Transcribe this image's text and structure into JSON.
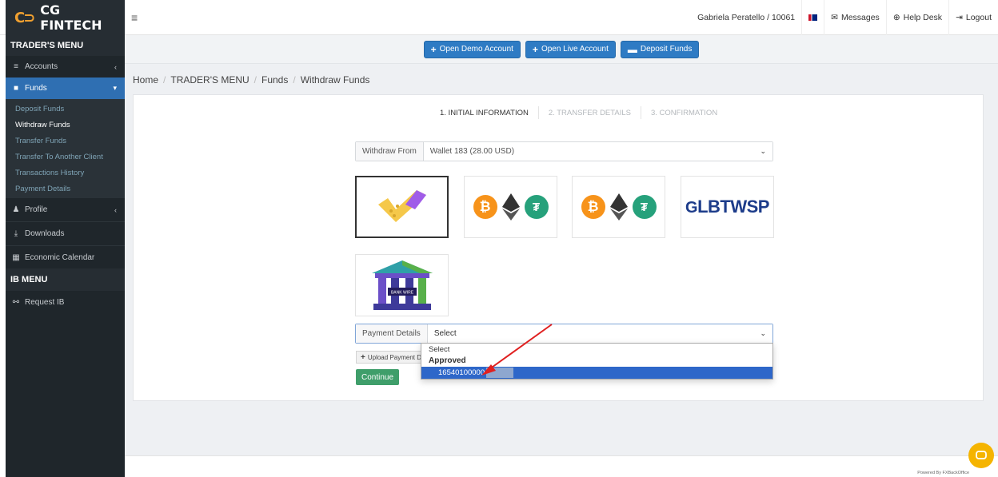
{
  "topbar": {
    "brand_mark": "C⊃",
    "brand_name": "CG FINTECH",
    "user": "Gabriela Peratello / 10061",
    "messages": "Messages",
    "help_desk": "Help Desk",
    "logout": "Logout"
  },
  "sidebar": {
    "traders_menu": "TRADER'S MENU",
    "accounts": "Accounts",
    "funds": "Funds",
    "funds_sub": [
      "Deposit Funds",
      "Withdraw Funds",
      "Transfer Funds",
      "Transfer To Another Client",
      "Transactions History",
      "Payment Details"
    ],
    "profile": "Profile",
    "downloads": "Downloads",
    "economic_calendar": "Economic Calendar",
    "ib_menu": "IB MENU",
    "request_ib": "Request IB"
  },
  "actions": {
    "open_demo": "Open Demo Account",
    "open_live": "Open Live Account",
    "deposit": "Deposit Funds"
  },
  "breadcrumb": [
    "Home",
    "TRADER'S MENU",
    "Funds",
    "Withdraw Funds"
  ],
  "steps": [
    "1. INITIAL INFORMATION",
    "2. TRANSFER DETAILS",
    "3. CONFIRMATION"
  ],
  "withdraw": {
    "label": "Withdraw From",
    "value": "Wallet 183 (28.00 USD)"
  },
  "methods": {
    "lbtwsp": "LBTWSP",
    "bank_wire": "BANK WIRE"
  },
  "payment": {
    "label": "Payment Details",
    "value": "Select",
    "upload": "Upload Payment D",
    "continue": "Continue"
  },
  "dropdown": {
    "opt_select": "Select",
    "group": "Approved",
    "selected": "16540100000"
  },
  "footer": {
    "powered": "Powered By FXBackOffice"
  },
  "colors": {
    "sidebar_bg": "#1f262b",
    "active": "#2f6fb2",
    "primary_button": "#2e7bc4",
    "continue": "#3f9e6a",
    "chat": "#f5b400",
    "annotation_arrow": "#e02020"
  }
}
